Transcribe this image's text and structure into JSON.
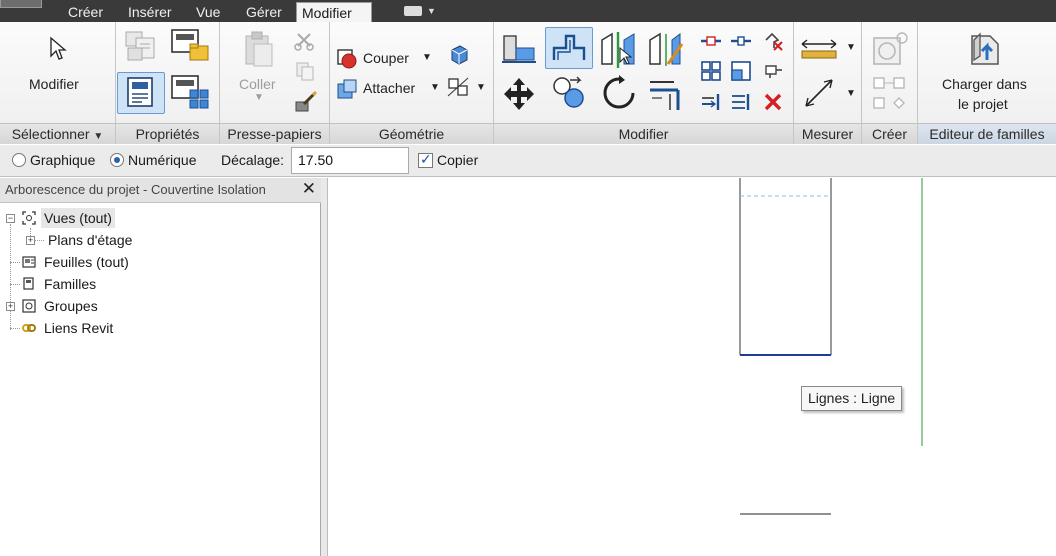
{
  "tabs": [
    {
      "label": "Créer"
    },
    {
      "label": "Insérer"
    },
    {
      "label": "Vue"
    },
    {
      "label": "Gérer"
    },
    {
      "label": "Modifier",
      "active": true
    }
  ],
  "ribbon": {
    "select_panel": {
      "title": "Sélectionner",
      "modify_label": "Modifier"
    },
    "properties_panel": {
      "title": "Propriétés"
    },
    "clipboard_panel": {
      "title": "Presse-papiers",
      "paste_label": "Coller"
    },
    "geometry_panel": {
      "title": "Géométrie",
      "cut_label": "Couper",
      "join_label": "Attacher"
    },
    "modify_panel": {
      "title": "Modifier"
    },
    "measure_panel": {
      "title": "Mesurer"
    },
    "create_panel": {
      "title": "Créer"
    },
    "family_editor_panel": {
      "title": "Editeur de familles",
      "load_label_1": "Charger dans",
      "load_label_2": "le projet"
    }
  },
  "options_bar": {
    "graphic_label": "Graphique",
    "numeric_label": "Numérique",
    "numeric_selected": true,
    "offset_label": "Décalage:",
    "offset_value": "17.50",
    "copy_label": "Copier",
    "copy_checked": true
  },
  "project_browser": {
    "title": "Arborescence du projet - Couvertine Isolation",
    "items": [
      {
        "label": "Vues (tout)"
      },
      {
        "label": "Plans d'étage"
      },
      {
        "label": "Feuilles (tout)"
      },
      {
        "label": "Familles"
      },
      {
        "label": "Groupes"
      },
      {
        "label": "Liens Revit"
      }
    ]
  },
  "canvas": {
    "tooltip": "Lignes : Ligne"
  },
  "colors": {
    "accent_blue": "#2b6fc0",
    "selected_tool_bg": "#cfe3f7",
    "delete_red": "#d42020",
    "reference_green": "#2a9a3a",
    "link_gold": "#d4a017"
  }
}
